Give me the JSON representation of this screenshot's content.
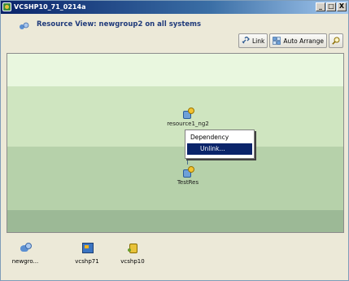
{
  "window": {
    "title": "VCSHP10_71_0214a",
    "buttons": [
      "_",
      "□",
      "X"
    ]
  },
  "header": {
    "title": "Resource View: newgroup2 on all systems"
  },
  "toolbar": {
    "link_label": "Link",
    "auto_arrange_label": "Auto Arrange"
  },
  "canvas": {
    "nodes": [
      {
        "label": "resource1_ng2",
        "icon": "resource-icon"
      },
      {
        "label": "TestRes",
        "icon": "resource-icon"
      }
    ],
    "context_menu": {
      "items": [
        "Dependency",
        "Unlink..."
      ]
    }
  },
  "systems": [
    {
      "label": "newgro...",
      "icon": "group-icon"
    },
    {
      "label": "vcshp71",
      "icon": "server-icon"
    },
    {
      "label": "vcshp10",
      "icon": "system-icon"
    }
  ],
  "colors": {
    "titlebar_start": "#0a246a",
    "band_1": "#e9f7df",
    "band_2": "#cfe5c0",
    "band_3": "#b6d1aa",
    "band_4": "#9cb996",
    "menu_highlight": "#0a246a"
  }
}
